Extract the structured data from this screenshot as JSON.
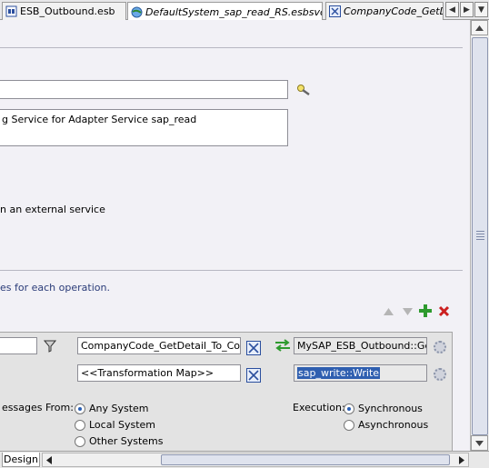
{
  "tabs": [
    {
      "label": "ESB_Outbound.esb",
      "icon": "esb-file-icon",
      "italic": false,
      "active": false
    },
    {
      "label": "DefaultSystem_sap_read_RS.esbsvc",
      "icon": "routing-service-icon",
      "italic": true,
      "active": true
    },
    {
      "label": "CompanyCode_GetDe",
      "icon": "transformation-map-icon",
      "italic": true,
      "active": false
    }
  ],
  "tab_nav": {
    "left": "◀",
    "right": "▶",
    "menu": "▼"
  },
  "form": {
    "description_text": "g Service for Adapter Service sap_read",
    "external_service_label": "n an external service",
    "operations_hint": "es for each operation."
  },
  "operation_panel": {
    "transformation_field_value": "CompanyCode_GetDetail_To_Compa",
    "transformation_map_placeholder": "<<Transformation Map>>",
    "target_service_value": "MySAP_ESB_Outbound::GetD",
    "target_operation_value": "sap_write::Write",
    "accept_messages_label": "essages From:",
    "accept_options": [
      {
        "label": "Any System",
        "selected": true
      },
      {
        "label": "Local System",
        "selected": false
      },
      {
        "label": "Other Systems",
        "selected": false
      }
    ],
    "execution_label": "Execution:",
    "execution_options": [
      {
        "label": "Synchronous",
        "selected": true
      },
      {
        "label": "Asynchronous",
        "selected": false
      }
    ]
  },
  "bottom": {
    "design_tab": "Design"
  },
  "colors": {
    "add_green": "#2e9a2e",
    "delete_red": "#cc2020",
    "selection_blue": "#2f5fb0"
  }
}
